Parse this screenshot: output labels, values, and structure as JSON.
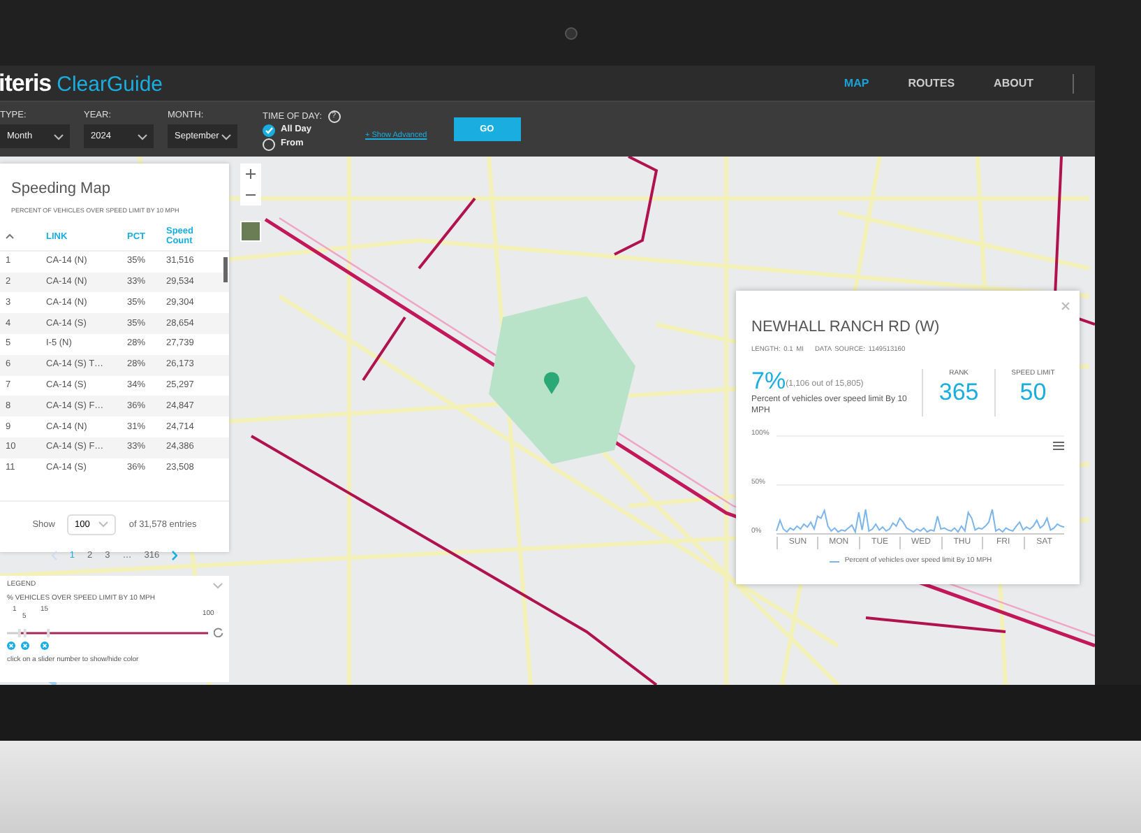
{
  "header": {
    "brand": "iteris",
    "product": "ClearGuide",
    "nav": [
      {
        "label": "MAP",
        "selected": true
      },
      {
        "label": "ROUTES",
        "selected": false
      },
      {
        "label": "ABOUT",
        "selected": false
      }
    ]
  },
  "filters": {
    "selects": [
      {
        "label": "TYPE:",
        "value": "Month"
      },
      {
        "label": "YEAR:",
        "value": "2024"
      },
      {
        "label": "MONTH:",
        "value": "September"
      }
    ],
    "time_of_day": {
      "label": "TIME OF DAY:",
      "help": "?",
      "options": [
        {
          "label": "All Day",
          "selected": true
        },
        {
          "label": "From",
          "selected": false
        }
      ]
    },
    "show_advanced": "+ Show Advanced",
    "go": "GO"
  },
  "speeding_panel": {
    "title": "Speeding Map",
    "subtitle": "PERCENT OF VEHICLES OVER SPEED LIMIT BY 10 MPH",
    "columns": [
      "LINK",
      "PCT",
      "Speed Count"
    ],
    "rows": [
      {
        "rank": "1",
        "link": "CA-14 (N)",
        "pct": "35%",
        "count": "31,516"
      },
      {
        "rank": "2",
        "link": "CA-14 (N)",
        "pct": "33%",
        "count": "29,534"
      },
      {
        "rank": "3",
        "link": "CA-14 (N)",
        "pct": "35%",
        "count": "29,304"
      },
      {
        "rank": "4",
        "link": "CA-14 (S)",
        "pct": "35%",
        "count": "28,654"
      },
      {
        "rank": "5",
        "link": "I-5 (N)",
        "pct": "28%",
        "count": "27,739"
      },
      {
        "rank": "6",
        "link": "CA-14 (S) T…",
        "pct": "28%",
        "count": "26,173"
      },
      {
        "rank": "7",
        "link": "CA-14 (S)",
        "pct": "34%",
        "count": "25,297"
      },
      {
        "rank": "8",
        "link": "CA-14 (S) F…",
        "pct": "36%",
        "count": "24,847"
      },
      {
        "rank": "9",
        "link": "CA-14 (N)",
        "pct": "31%",
        "count": "24,714"
      },
      {
        "rank": "10",
        "link": "CA-14 (S) F…",
        "pct": "33%",
        "count": "24,386"
      },
      {
        "rank": "11",
        "link": "CA-14 (S)",
        "pct": "36%",
        "count": "23,508"
      }
    ],
    "show_label": "Show",
    "page_size": "100",
    "entries": "of 31,578 entries",
    "pages": [
      {
        "label": "1",
        "selected": true
      },
      {
        "label": "2",
        "selected": false
      },
      {
        "label": "3",
        "selected": false
      },
      {
        "label": "…",
        "selected": false
      },
      {
        "label": "316",
        "selected": false
      }
    ]
  },
  "legend": {
    "title": "LEGEND",
    "subtitle": "% VEHICLES OVER SPEED LIMIT BY 10 MPH",
    "slider_labels": [
      "1",
      "5",
      "15",
      "100"
    ],
    "hint": "click on a slider number to show/hide color"
  },
  "popup": {
    "title": "NEWHALL RANCH RD (W)",
    "length": "LENGTH: 0.1 MI",
    "source": "DATA SOURCE: 1149513160",
    "pct": "7%",
    "pct_detail": "(1,106 out of 15,805)",
    "pct_caption": "Percent of vehicles over speed limit By 10 MPH",
    "stats": [
      {
        "label": "RANK",
        "value": "365"
      },
      {
        "label": "SPEED LIMIT",
        "value": "50"
      }
    ],
    "chart": {
      "y_labels": [
        "100%",
        "50%",
        "0%"
      ],
      "x_labels": [
        "SUN",
        "MON",
        "TUE",
        "WED",
        "THU",
        "FRI",
        "SAT"
      ],
      "legend": "Percent of vehicles over speed limit By 10 MPH"
    }
  }
}
